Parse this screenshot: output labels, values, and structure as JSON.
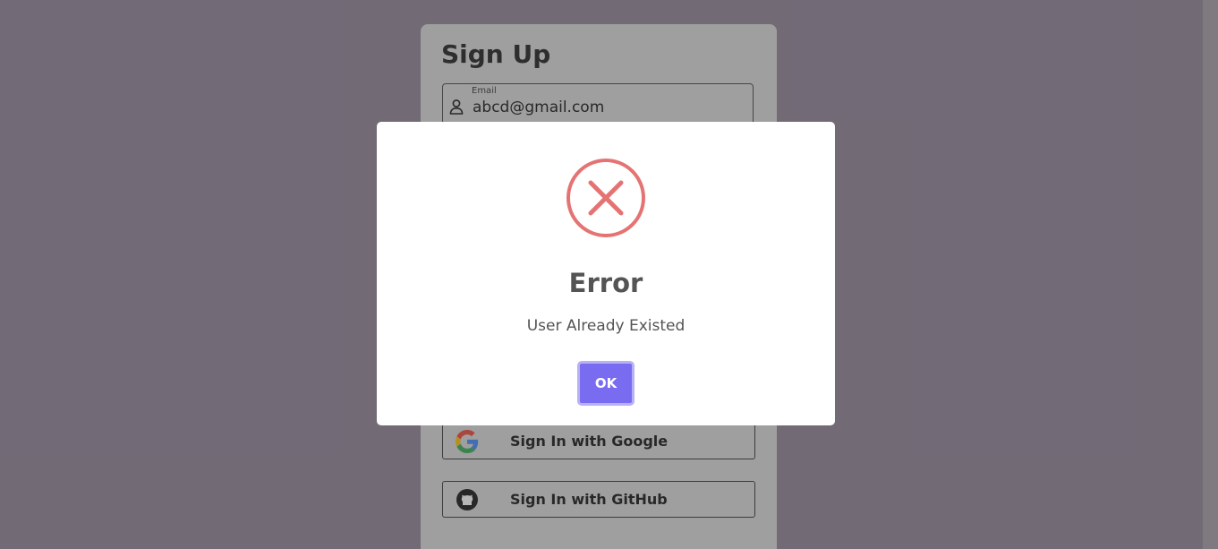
{
  "signup": {
    "title": "Sign Up",
    "email_label": "Email",
    "email_value": "abcd@gmail.com",
    "google_label": "Sign In with Google",
    "github_label": "Sign In with GitHub"
  },
  "modal": {
    "title": "Error",
    "message": "User Already Existed",
    "ok_label": "OK",
    "icon": "error-x-icon",
    "icon_color": "#e57373",
    "button_color": "#7a6cf0"
  },
  "colors": {
    "page_background": "#8d8093",
    "modal_background": "#ffffff"
  }
}
